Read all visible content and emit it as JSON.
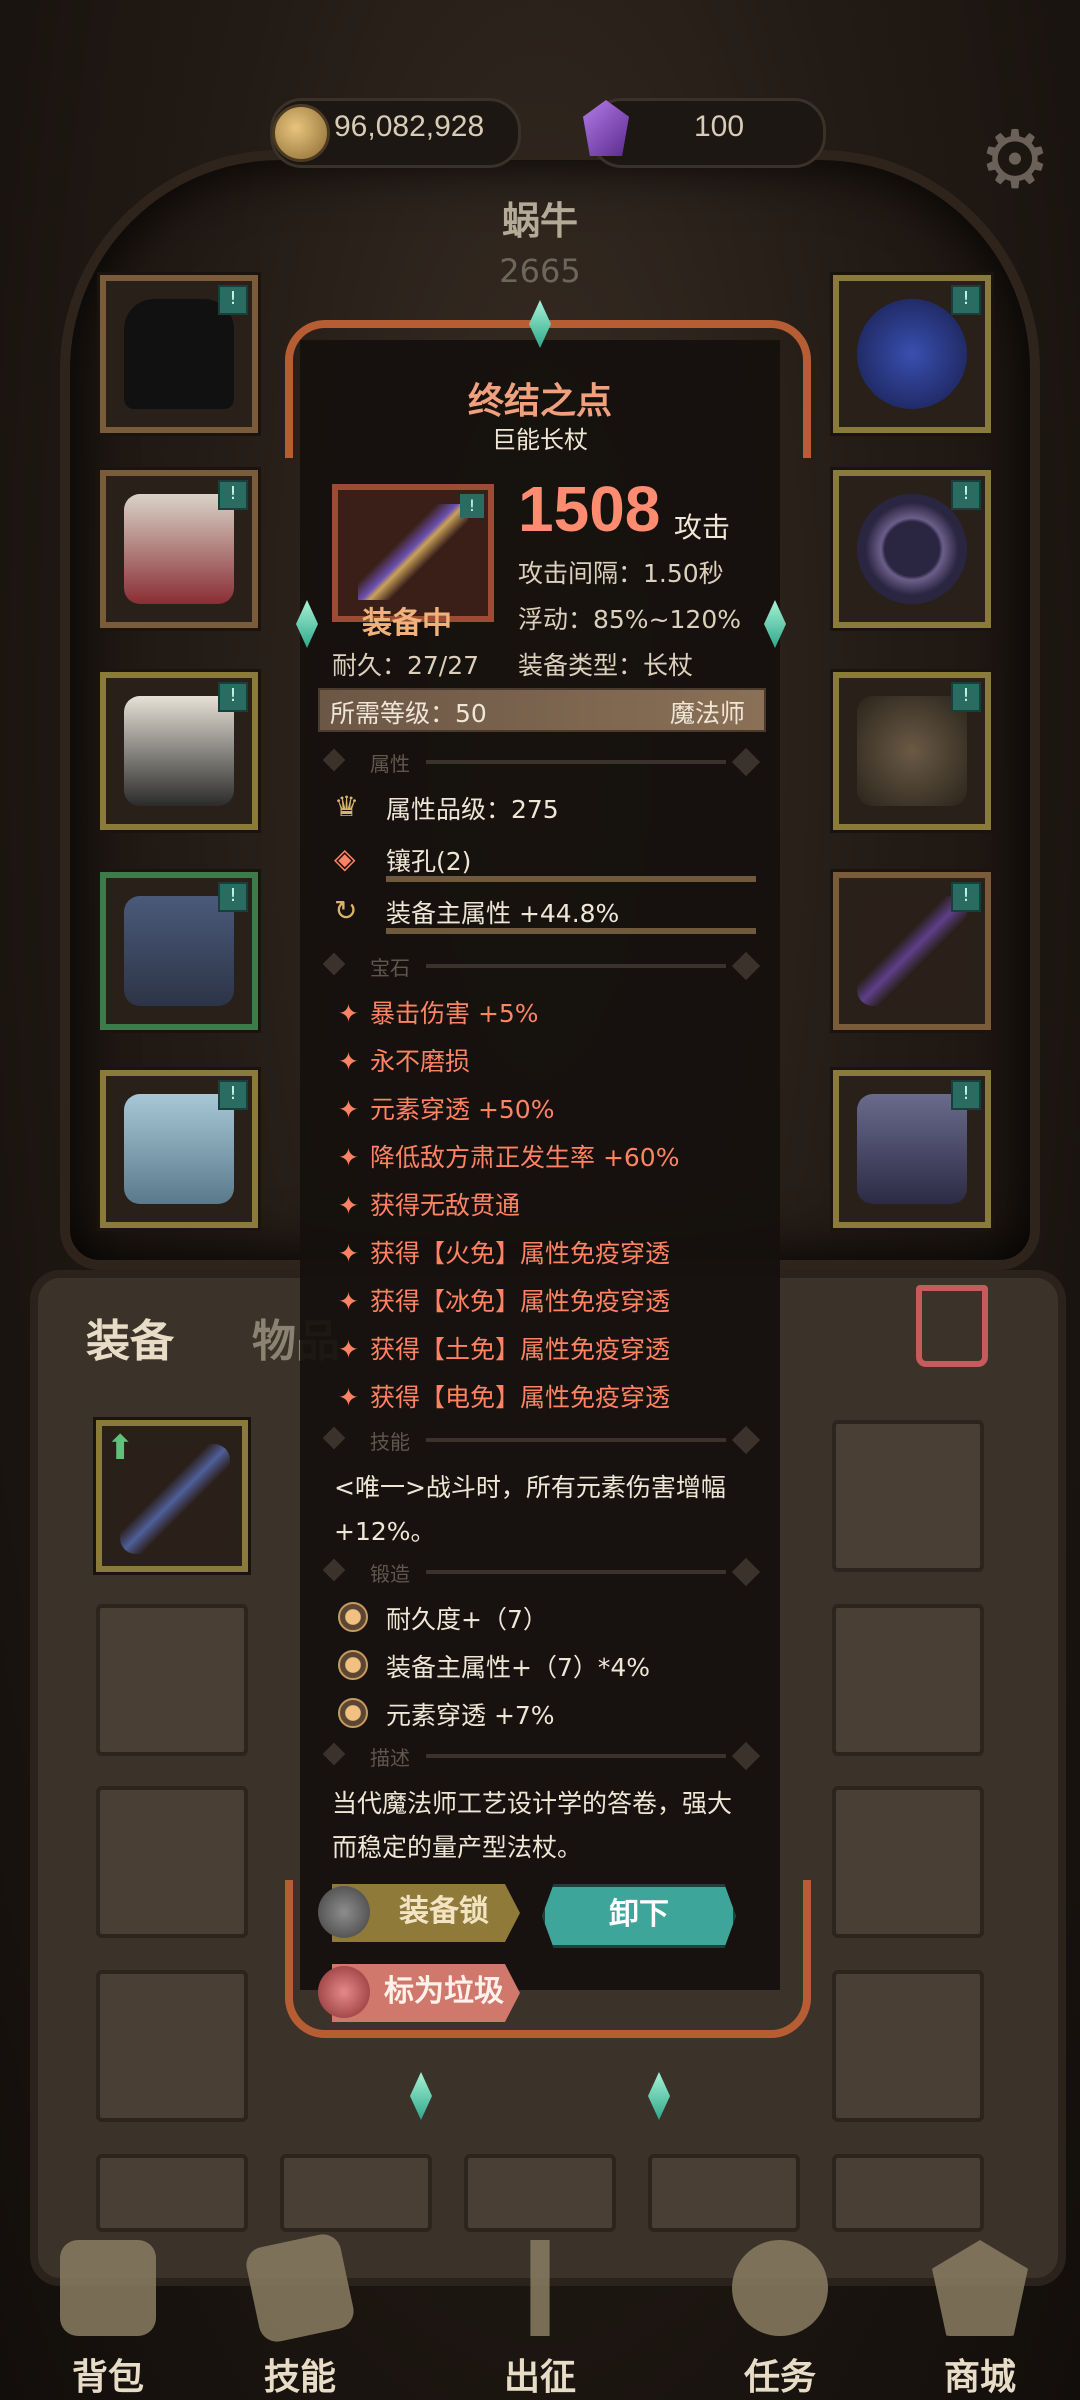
{
  "currency": {
    "gold": "96,082,928",
    "gems": "100"
  },
  "character": {
    "name": "蜗牛",
    "power": "2665"
  },
  "tabs": {
    "equipment": "装备",
    "items": "物品"
  },
  "item": {
    "name": "终结之点",
    "subtype": "巨能长杖",
    "attack_value": "1508",
    "attack_label": "攻击",
    "equipped_label": "装备中",
    "attack_interval": "攻击间隔：1.50秒",
    "fluctuation": "浮动：85%~120%",
    "durability": "耐久：27/27",
    "equip_type": "装备类型：长杖",
    "required_level": "所需等级：50",
    "class": "魔法师",
    "sections": {
      "attributes": "属性",
      "gems": "宝石",
      "skills": "技能",
      "forge": "锻造",
      "description": "描述"
    },
    "attributes": [
      {
        "icon": "crown-icon",
        "text": "属性品级：275"
      },
      {
        "icon": "socket-icon",
        "text": "镶孔(2)"
      },
      {
        "icon": "refresh-icon",
        "text": "装备主属性 +44.8%"
      }
    ],
    "gems": [
      "暴击伤害 +5%",
      "永不磨损",
      "元素穿透 +50%",
      "降低敌方肃正发生率 +60%",
      "获得无敌贯通",
      "获得【火免】属性免疫穿透",
      "获得【冰免】属性免疫穿透",
      "获得【土免】属性免疫穿透",
      "获得【电免】属性免疫穿透"
    ],
    "skill_line1": "<唯一>战斗时，所有元素伤害增幅",
    "skill_line2": "+12%。",
    "forge": [
      "耐久度+（7）",
      "装备主属性+（7）*4%",
      "元素穿透 +7%"
    ],
    "desc_line1": "当代魔法师工艺设计学的答卷，强大",
    "desc_line2": "而稳定的量产型法杖。"
  },
  "buttons": {
    "lock": "装备锁",
    "unequip": "卸下",
    "mark_trash": "标为垃圾"
  },
  "nav": [
    "背包",
    "技能",
    "出征",
    "任务",
    "商城"
  ],
  "colors": {
    "accent": "#ff8262",
    "frame": "#b65d34",
    "unequip": "#3ea59a"
  }
}
